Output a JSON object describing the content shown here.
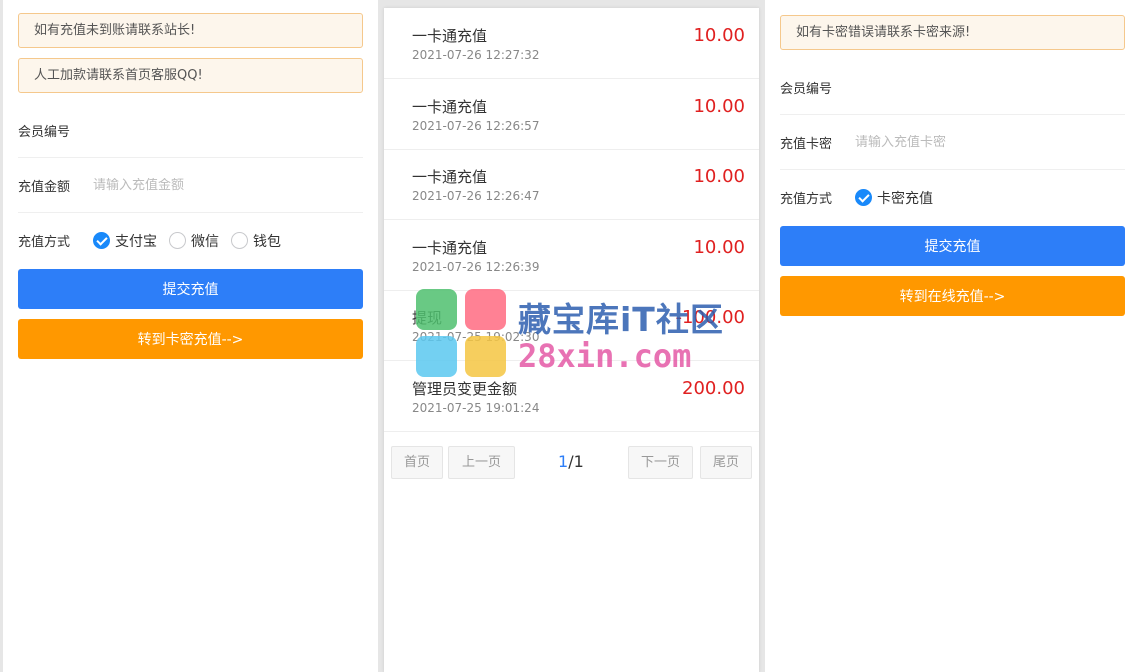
{
  "left": {
    "notices": [
      "如有充值未到账请联系站长!",
      "人工加款请联系首页客服QQ!"
    ],
    "member_label": "会员编号",
    "amount_label": "充值金额",
    "amount_placeholder": "请输入充值金额",
    "method_label": "充值方式",
    "methods": [
      {
        "label": "支付宝",
        "checked": true
      },
      {
        "label": "微信",
        "checked": false
      },
      {
        "label": "钱包",
        "checked": false
      }
    ],
    "submit_label": "提交充值",
    "switch_label": "转到卡密充值-->"
  },
  "records": [
    {
      "title": "一卡通充值",
      "time": "2021-07-26 12:27:32",
      "amount": "10.00"
    },
    {
      "title": "一卡通充值",
      "time": "2021-07-26 12:26:57",
      "amount": "10.00"
    },
    {
      "title": "一卡通充值",
      "time": "2021-07-26 12:26:47",
      "amount": "10.00"
    },
    {
      "title": "一卡通充值",
      "time": "2021-07-26 12:26:39",
      "amount": "10.00"
    },
    {
      "title": "提现",
      "time": "2021-07-25 19:02:30",
      "amount": "-100.00"
    },
    {
      "title": "管理员变更金额",
      "time": "2021-07-25 19:01:24",
      "amount": "200.00"
    }
  ],
  "pager": {
    "first": "首页",
    "prev": "上一页",
    "current": "1",
    "sep": "/",
    "total": "1",
    "next": "下一页",
    "last": "尾页"
  },
  "right": {
    "notice": "如有卡密错误请联系卡密来源!",
    "member_label": "会员编号",
    "card_label": "充值卡密",
    "card_placeholder": "请输入充值卡密",
    "method_label": "充值方式",
    "method_option": "卡密充值",
    "submit_label": "提交充值",
    "switch_label": "转到在线充值-->"
  },
  "watermark": {
    "line1": "藏宝库iT社区",
    "line2": "28xin.com"
  },
  "colors": {
    "primary": "#2d7ef8",
    "orange": "#ff9800",
    "amount_red": "#e02020",
    "notice_bg": "#fdf6ec",
    "notice_border": "#f5c88c"
  }
}
